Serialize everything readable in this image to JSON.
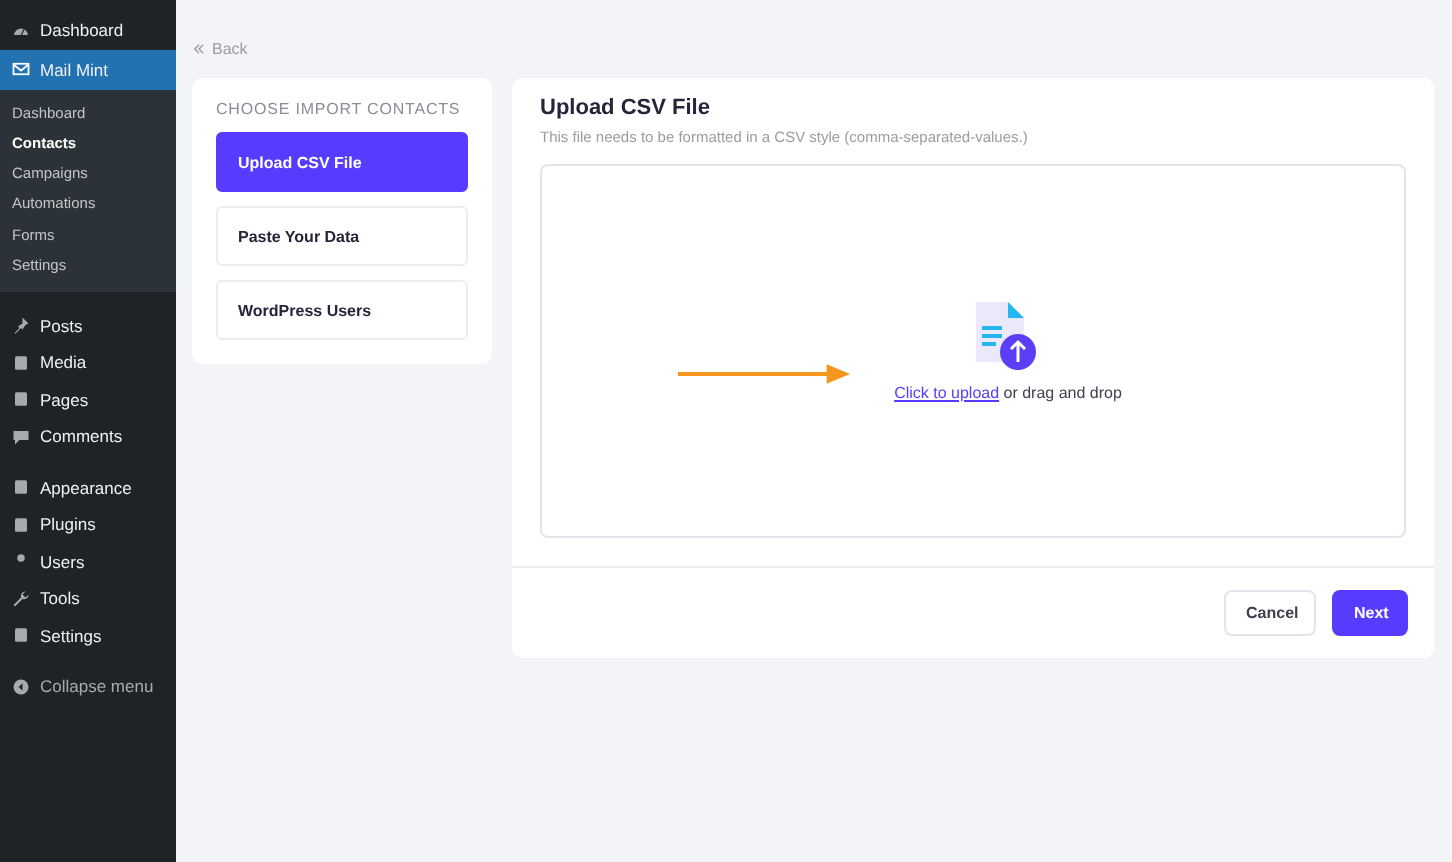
{
  "sidebar": {
    "groups": [
      [
        {
          "label": "Dashboard",
          "selected": false
        },
        {
          "label": "Mail Mint",
          "selected": true,
          "children": [
            {
              "label": "Dashboard",
              "selected": false
            },
            {
              "label": "Contacts",
              "selected": true
            },
            {
              "label": "Campaigns",
              "selected": false
            },
            {
              "label": "Automations",
              "selected": false
            },
            {
              "label": "Forms",
              "selected": false
            },
            {
              "label": "Settings",
              "selected": false
            }
          ]
        }
      ],
      [
        {
          "label": "Posts",
          "selected": false
        },
        {
          "label": "Media",
          "selected": false
        },
        {
          "label": "Pages",
          "selected": false
        },
        {
          "label": "Comments",
          "selected": false
        }
      ],
      [
        {
          "label": "Appearance",
          "selected": false
        },
        {
          "label": "Plugins",
          "selected": false
        },
        {
          "label": "Users",
          "selected": false
        },
        {
          "label": "Tools",
          "selected": false
        },
        {
          "label": "Settings",
          "selected": false
        }
      ]
    ],
    "collapse": "Collapse menu"
  },
  "back": "Back",
  "import_options": {
    "title": "CHOOSE IMPORT CONTACTS",
    "items": [
      {
        "label": "Upload CSV File",
        "selected": true
      },
      {
        "label": "Paste Your Data",
        "selected": false
      },
      {
        "label": "WordPress Users",
        "selected": false
      }
    ]
  },
  "upload": {
    "title": "Upload CSV File",
    "subtitle": "This file needs to be formatted in a CSV style (comma-separated-values.)",
    "link": "Click to upload",
    "rest": "or drag and drop"
  },
  "buttons": [
    {
      "label": "Cancel",
      "kind": "secondary"
    },
    {
      "label": "Next",
      "kind": "primary"
    }
  ]
}
